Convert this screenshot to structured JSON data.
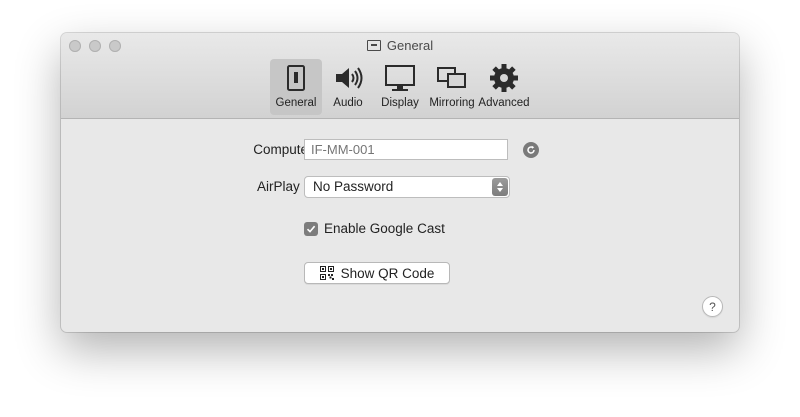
{
  "window": {
    "title": "General"
  },
  "toolbar": {
    "tabs": [
      {
        "label": "General",
        "icon": "switch-icon",
        "active": true
      },
      {
        "label": "Audio",
        "icon": "speaker-icon",
        "active": false
      },
      {
        "label": "Display",
        "icon": "monitor-icon",
        "active": false
      },
      {
        "label": "Mirroring",
        "icon": "mirroring-icon",
        "active": false
      },
      {
        "label": "Advanced",
        "icon": "gear-icon",
        "active": false
      }
    ]
  },
  "general": {
    "computer_name_label": "Computer Name:",
    "computer_name_placeholder": "IF-MM-001",
    "airplay_security_label": "AirPlay Security:",
    "airplay_security_value": "No Password",
    "google_cast_label": "Enable Google Cast",
    "google_cast_checked": true,
    "qr_button_label": "Show QR Code",
    "help_label": "?"
  }
}
